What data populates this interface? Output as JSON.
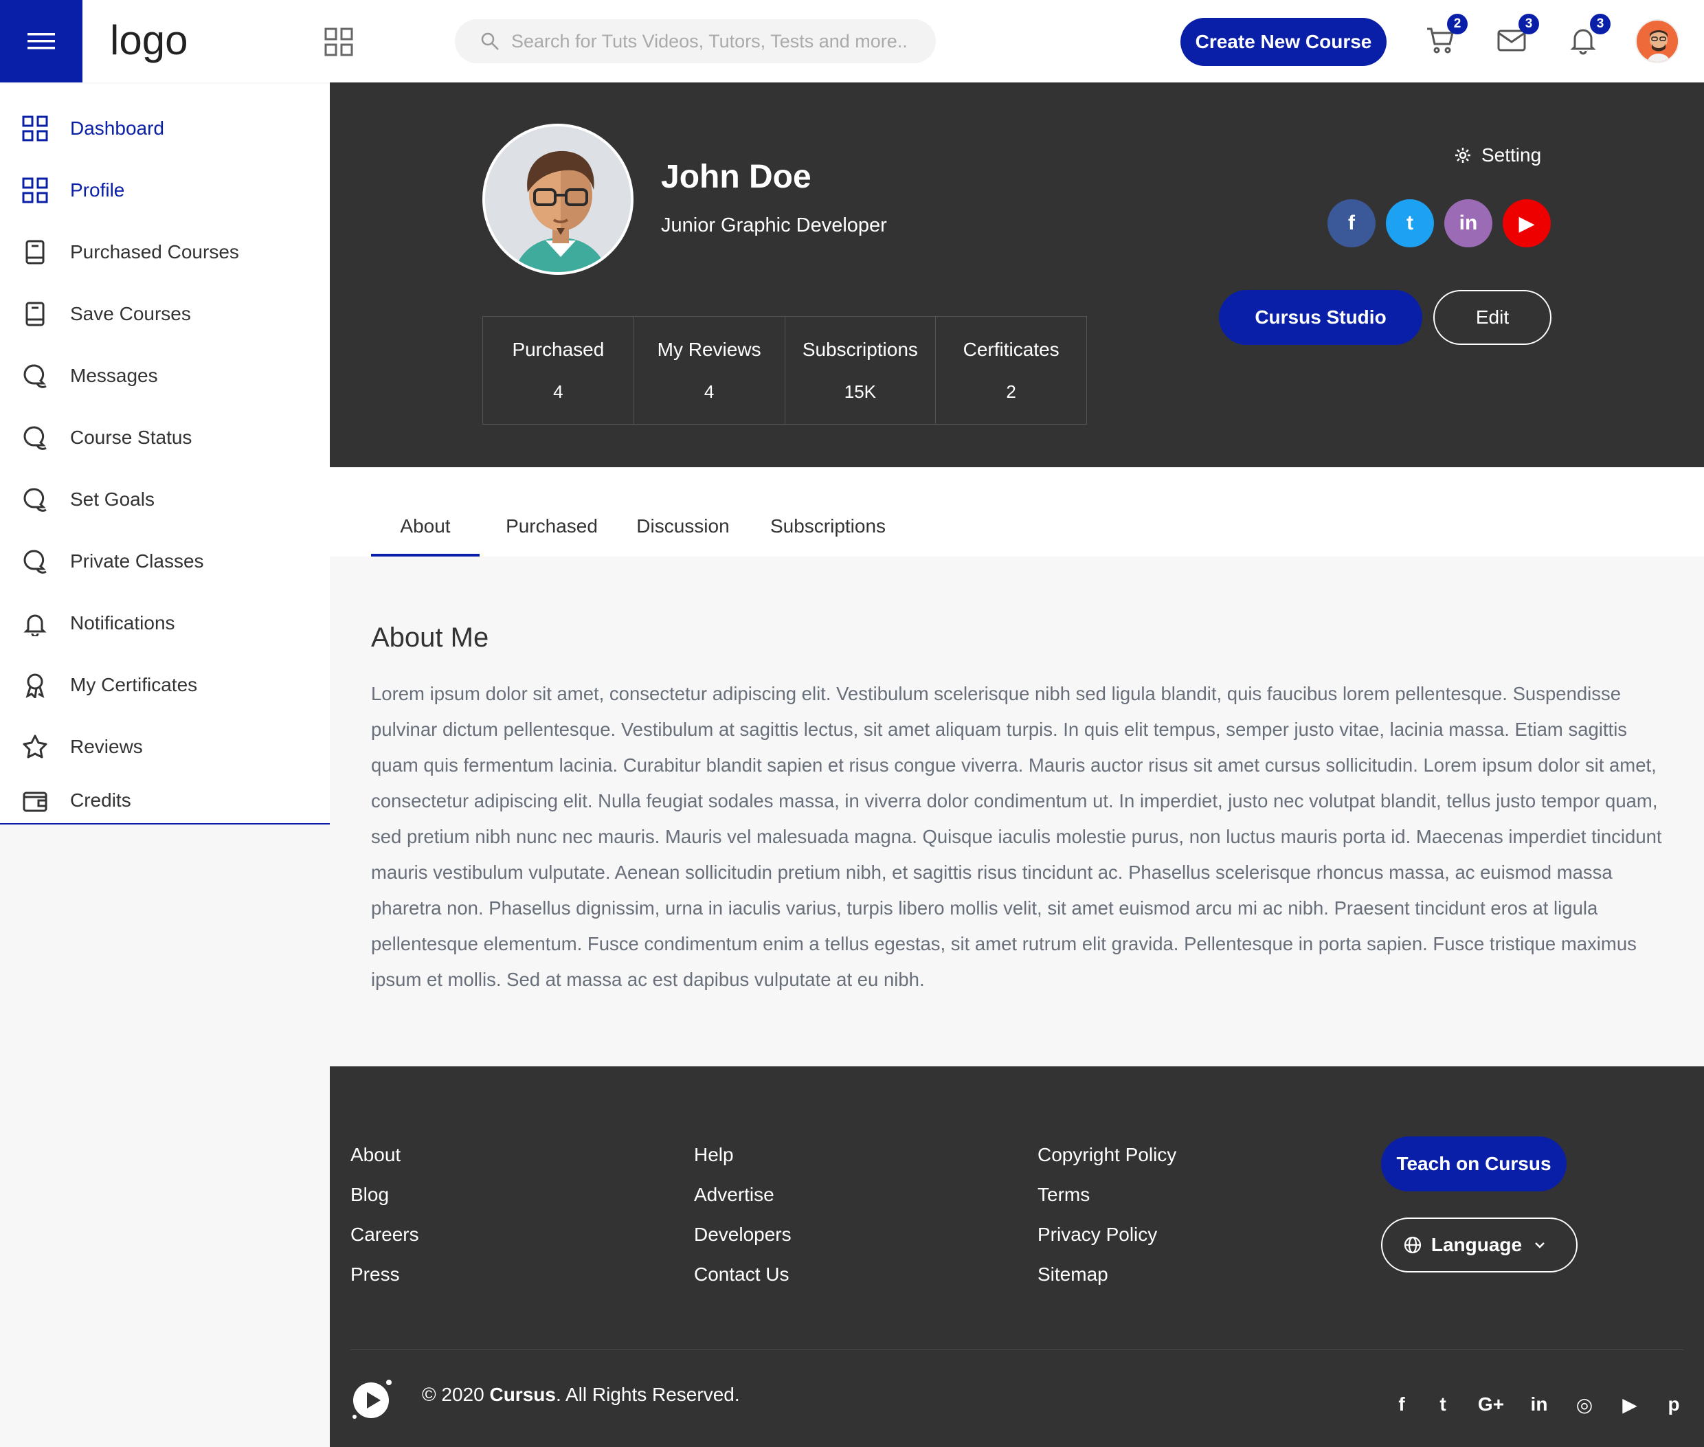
{
  "header": {
    "logo_text": "logo",
    "search_placeholder": "Search for Tuts Videos, Tutors, Tests and more..",
    "create_course_label": "Create New Course",
    "cart_badge": "2",
    "mail_badge": "3",
    "notif_badge": "3"
  },
  "sidebar": {
    "items": [
      {
        "label": "Dashboard",
        "icon": "grid-icon"
      },
      {
        "label": "Profile",
        "icon": "grid-icon"
      },
      {
        "label": "Purchased Courses",
        "icon": "book-icon"
      },
      {
        "label": "Save Courses",
        "icon": "book-icon"
      },
      {
        "label": "Messages",
        "icon": "chat-icon"
      },
      {
        "label": "Course Status",
        "icon": "chat-icon"
      },
      {
        "label": "Set Goals",
        "icon": "chat-icon"
      },
      {
        "label": "Private Classes",
        "icon": "chat-icon"
      },
      {
        "label": "Notifications",
        "icon": "bell-icon"
      },
      {
        "label": "My Certificates",
        "icon": "award-icon"
      },
      {
        "label": "Reviews",
        "icon": "star-icon"
      },
      {
        "label": "Credits",
        "icon": "wallet-icon"
      }
    ]
  },
  "profile": {
    "name": "John Doe",
    "role": "Junior Graphic Developer",
    "setting_label": "Setting",
    "stats": [
      {
        "title": "Purchased",
        "value": "4"
      },
      {
        "title": "My Reviews",
        "value": "4"
      },
      {
        "title": "Subscriptions",
        "value": "15K"
      },
      {
        "title": "Cerfiticates",
        "value": "2"
      }
    ],
    "socials": [
      {
        "icon": "facebook-icon",
        "color": "#3b5998",
        "glyph": "f"
      },
      {
        "icon": "twitter-icon",
        "color": "#1da1f2",
        "glyph": "t"
      },
      {
        "icon": "linkedin-icon",
        "color": "#9b6bb5",
        "glyph": "in"
      },
      {
        "icon": "youtube-icon",
        "color": "#ee0000",
        "glyph": "▶"
      }
    ],
    "studio_label": "Cursus Studio",
    "edit_label": "Edit"
  },
  "tabs": [
    {
      "label": "About",
      "active": true
    },
    {
      "label": "Purchased",
      "active": false
    },
    {
      "label": "Discussion",
      "active": false
    },
    {
      "label": "Subscriptions",
      "active": false
    }
  ],
  "about": {
    "title": "About Me",
    "text": "Lorem ipsum dolor sit amet, consectetur adipiscing elit. Vestibulum scelerisque nibh sed ligula blandit, quis faucibus lorem pellentesque. Suspendisse pulvinar dictum pellentesque. Vestibulum at sagittis lectus, sit amet aliquam turpis. In quis elit tempus, semper justo vitae, lacinia massa. Etiam sagittis quam quis fermentum lacinia. Curabitur blandit sapien et risus congue viverra. Mauris auctor risus sit amet cursus sollicitudin. Lorem ipsum dolor sit amet, consectetur adipiscing elit. Nulla feugiat sodales massa, in viverra dolor condimentum ut. In imperdiet, justo nec volutpat blandit, tellus justo tempor quam, sed pretium nibh nunc nec mauris. Mauris vel malesuada magna. Quisque iaculis molestie purus, non luctus mauris porta id. Maecenas imperdiet tincidunt mauris vestibulum vulputate. Aenean sollicitudin pretium nibh, et sagittis risus tincidunt ac. Phasellus scelerisque rhoncus massa, ac euismod massa pharetra non. Phasellus dignissim, urna in iaculis varius, turpis libero mollis velit, sit amet euismod arcu mi ac nibh. Praesent tincidunt eros at ligula pellentesque elementum. Fusce condimentum enim a tellus egestas, sit amet rutrum elit gravida. Pellentesque in porta sapien. Fusce tristique maximus ipsum et mollis. Sed at massa ac est dapibus vulputate at eu nibh."
  },
  "footer": {
    "col1": [
      "About",
      "Blog",
      "Careers",
      "Press"
    ],
    "col2": [
      "Help",
      "Advertise",
      "Developers",
      "Contact Us"
    ],
    "col3": [
      "Copyright Policy",
      "Terms",
      "Privacy Policy",
      "Sitemap"
    ],
    "teach_label": "Teach on Cursus",
    "language_label": "Language",
    "copyright_prefix": "© 2020",
    "copyright_brand": "Cursus",
    "copyright_suffix": ". All Rights Reserved.",
    "socials": [
      {
        "icon": "facebook-icon",
        "glyph": "f"
      },
      {
        "icon": "twitter-icon",
        "glyph": "t"
      },
      {
        "icon": "google-plus-icon",
        "glyph": "G+"
      },
      {
        "icon": "linkedin-icon",
        "glyph": "in"
      },
      {
        "icon": "instagram-icon",
        "glyph": "◎"
      },
      {
        "icon": "youtube-icon",
        "glyph": "▶"
      },
      {
        "icon": "pinterest-icon",
        "glyph": "p"
      }
    ]
  },
  "colors": {
    "accent": "#0a1fa8",
    "dark": "#333333"
  }
}
